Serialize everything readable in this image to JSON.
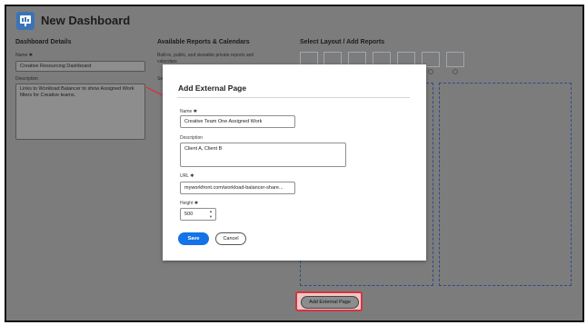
{
  "header": {
    "title": "New Dashboard"
  },
  "details": {
    "heading": "Dashboard Details",
    "name_label": "Name ✱",
    "name_value": "Creative Resourcing Dashboard",
    "description_label": "Description",
    "description_value": "Links to Workload Balancer to show Assigned Work filters for Creative teams."
  },
  "reports": {
    "heading": "Available Reports & Calendars",
    "note_line1": "Built-in, public, and viewable private reports and",
    "note_line2": "calendars",
    "filter_label": "Se"
  },
  "layout": {
    "heading": "Select Layout / Add Reports",
    "add_external_label": "Add External Page"
  },
  "modal": {
    "title": "Add External Page",
    "name_label": "Name ✱",
    "name_value": "Creative Team One Assigned Work",
    "description_label": "Description",
    "description_value": "Client A, Client B",
    "url_label": "URL ✱",
    "url_value": "myworkfront.com/workload-balancer-share...",
    "height_label": "Height ✱",
    "height_value": "500",
    "save_label": "Save",
    "cancel_label": "Cancel"
  },
  "colors": {
    "primary_blue": "#1473e6",
    "highlight_red": "#d1363f",
    "dashed_blue": "#2a4d8a",
    "overlay_gray": "#7c7c7c"
  }
}
